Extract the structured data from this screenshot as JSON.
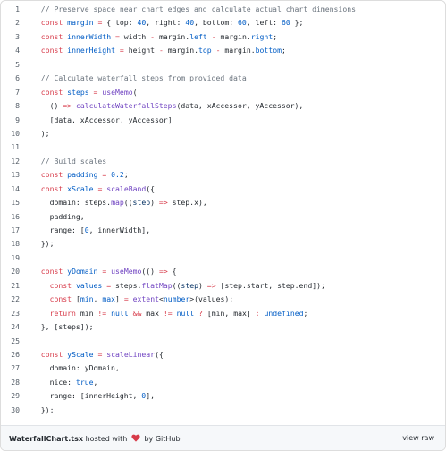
{
  "gist": {
    "lines": [
      {
        "n": "1",
        "tokens": [
          {
            "t": "  "
          },
          {
            "t": "// Preserve space near chart edges and calculate actual chart dimensions",
            "c": "cm"
          }
        ]
      },
      {
        "n": "2",
        "tokens": [
          {
            "t": "  "
          },
          {
            "t": "const",
            "c": "kw"
          },
          {
            "t": " "
          },
          {
            "t": "margin",
            "c": "cn"
          },
          {
            "t": " "
          },
          {
            "t": "=",
            "c": "kw"
          },
          {
            "t": " { top: "
          },
          {
            "t": "40",
            "c": "cn"
          },
          {
            "t": ", right: "
          },
          {
            "t": "40",
            "c": "cn"
          },
          {
            "t": ", bottom: "
          },
          {
            "t": "60",
            "c": "cn"
          },
          {
            "t": ", left: "
          },
          {
            "t": "60",
            "c": "cn"
          },
          {
            "t": " };"
          }
        ]
      },
      {
        "n": "3",
        "tokens": [
          {
            "t": "  "
          },
          {
            "t": "const",
            "c": "kw"
          },
          {
            "t": " "
          },
          {
            "t": "innerWidth",
            "c": "cn"
          },
          {
            "t": " "
          },
          {
            "t": "=",
            "c": "kw"
          },
          {
            "t": " width "
          },
          {
            "t": "-",
            "c": "kw"
          },
          {
            "t": " margin."
          },
          {
            "t": "left",
            "c": "cn"
          },
          {
            "t": " "
          },
          {
            "t": "-",
            "c": "kw"
          },
          {
            "t": " margin."
          },
          {
            "t": "right",
            "c": "cn"
          },
          {
            "t": ";"
          }
        ]
      },
      {
        "n": "4",
        "tokens": [
          {
            "t": "  "
          },
          {
            "t": "const",
            "c": "kw"
          },
          {
            "t": " "
          },
          {
            "t": "innerHeight",
            "c": "cn"
          },
          {
            "t": " "
          },
          {
            "t": "=",
            "c": "kw"
          },
          {
            "t": " height "
          },
          {
            "t": "-",
            "c": "kw"
          },
          {
            "t": " margin."
          },
          {
            "t": "top",
            "c": "cn"
          },
          {
            "t": " "
          },
          {
            "t": "-",
            "c": "kw"
          },
          {
            "t": " margin."
          },
          {
            "t": "bottom",
            "c": "cn"
          },
          {
            "t": ";"
          }
        ]
      },
      {
        "n": "5",
        "tokens": []
      },
      {
        "n": "6",
        "tokens": [
          {
            "t": "  "
          },
          {
            "t": "// Calculate waterfall steps from provided data",
            "c": "cm"
          }
        ]
      },
      {
        "n": "7",
        "tokens": [
          {
            "t": "  "
          },
          {
            "t": "const",
            "c": "kw"
          },
          {
            "t": " "
          },
          {
            "t": "steps",
            "c": "cn"
          },
          {
            "t": " "
          },
          {
            "t": "=",
            "c": "kw"
          },
          {
            "t": " "
          },
          {
            "t": "useMemo",
            "c": "fn"
          },
          {
            "t": "("
          }
        ]
      },
      {
        "n": "8",
        "tokens": [
          {
            "t": "    () "
          },
          {
            "t": "=>",
            "c": "kw"
          },
          {
            "t": " "
          },
          {
            "t": "calculateWaterfallSteps",
            "c": "fn"
          },
          {
            "t": "(data, xAccessor, yAccessor),"
          }
        ]
      },
      {
        "n": "9",
        "tokens": [
          {
            "t": "    [data, xAccessor, yAccessor]"
          }
        ]
      },
      {
        "n": "10",
        "tokens": [
          {
            "t": "  );"
          }
        ]
      },
      {
        "n": "11",
        "tokens": []
      },
      {
        "n": "12",
        "tokens": [
          {
            "t": "  "
          },
          {
            "t": "// Build scales",
            "c": "cm"
          }
        ]
      },
      {
        "n": "13",
        "tokens": [
          {
            "t": "  "
          },
          {
            "t": "const",
            "c": "kw"
          },
          {
            "t": " "
          },
          {
            "t": "padding",
            "c": "cn"
          },
          {
            "t": " "
          },
          {
            "t": "=",
            "c": "kw"
          },
          {
            "t": " "
          },
          {
            "t": "0.2",
            "c": "cn"
          },
          {
            "t": ";"
          }
        ]
      },
      {
        "n": "14",
        "tokens": [
          {
            "t": "  "
          },
          {
            "t": "const",
            "c": "kw"
          },
          {
            "t": " "
          },
          {
            "t": "xScale",
            "c": "cn"
          },
          {
            "t": " "
          },
          {
            "t": "=",
            "c": "kw"
          },
          {
            "t": " "
          },
          {
            "t": "scaleBand",
            "c": "fn"
          },
          {
            "t": "({"
          }
        ]
      },
      {
        "n": "15",
        "tokens": [
          {
            "t": "    domain: steps."
          },
          {
            "t": "map",
            "c": "fn"
          },
          {
            "t": "(("
          },
          {
            "t": "step",
            "c": "st"
          },
          {
            "t": ") "
          },
          {
            "t": "=>",
            "c": "kw"
          },
          {
            "t": " step.x),"
          }
        ]
      },
      {
        "n": "16",
        "tokens": [
          {
            "t": "    padding,"
          }
        ]
      },
      {
        "n": "17",
        "tokens": [
          {
            "t": "    range: ["
          },
          {
            "t": "0",
            "c": "cn"
          },
          {
            "t": ", innerWidth],"
          }
        ]
      },
      {
        "n": "18",
        "tokens": [
          {
            "t": "  });"
          }
        ]
      },
      {
        "n": "19",
        "tokens": []
      },
      {
        "n": "20",
        "tokens": [
          {
            "t": "  "
          },
          {
            "t": "const",
            "c": "kw"
          },
          {
            "t": " "
          },
          {
            "t": "yDomain",
            "c": "cn"
          },
          {
            "t": " "
          },
          {
            "t": "=",
            "c": "kw"
          },
          {
            "t": " "
          },
          {
            "t": "useMemo",
            "c": "fn"
          },
          {
            "t": "(() "
          },
          {
            "t": "=>",
            "c": "kw"
          },
          {
            "t": " {"
          }
        ]
      },
      {
        "n": "21",
        "tokens": [
          {
            "t": "    "
          },
          {
            "t": "const",
            "c": "kw"
          },
          {
            "t": " "
          },
          {
            "t": "values",
            "c": "cn"
          },
          {
            "t": " "
          },
          {
            "t": "=",
            "c": "kw"
          },
          {
            "t": " steps."
          },
          {
            "t": "flatMap",
            "c": "fn"
          },
          {
            "t": "(("
          },
          {
            "t": "step",
            "c": "st"
          },
          {
            "t": ") "
          },
          {
            "t": "=>",
            "c": "kw"
          },
          {
            "t": " [step.start, step.end]);"
          }
        ]
      },
      {
        "n": "22",
        "tokens": [
          {
            "t": "    "
          },
          {
            "t": "const",
            "c": "kw"
          },
          {
            "t": " ["
          },
          {
            "t": "min",
            "c": "cn"
          },
          {
            "t": ", "
          },
          {
            "t": "max",
            "c": "cn"
          },
          {
            "t": "] "
          },
          {
            "t": "=",
            "c": "kw"
          },
          {
            "t": " "
          },
          {
            "t": "extent",
            "c": "fn"
          },
          {
            "t": "<"
          },
          {
            "t": "number",
            "c": "cn"
          },
          {
            "t": ">(values);"
          }
        ]
      },
      {
        "n": "23",
        "tokens": [
          {
            "t": "    "
          },
          {
            "t": "return",
            "c": "kw"
          },
          {
            "t": " min "
          },
          {
            "t": "!=",
            "c": "kw"
          },
          {
            "t": " "
          },
          {
            "t": "null",
            "c": "cn"
          },
          {
            "t": " "
          },
          {
            "t": "&&",
            "c": "kw"
          },
          {
            "t": " max "
          },
          {
            "t": "!=",
            "c": "kw"
          },
          {
            "t": " "
          },
          {
            "t": "null",
            "c": "cn"
          },
          {
            "t": " "
          },
          {
            "t": "?",
            "c": "kw"
          },
          {
            "t": " [min, max] "
          },
          {
            "t": ":",
            "c": "kw"
          },
          {
            "t": " "
          },
          {
            "t": "undefined",
            "c": "cn"
          },
          {
            "t": ";"
          }
        ]
      },
      {
        "n": "24",
        "tokens": [
          {
            "t": "  }, [steps]);"
          }
        ]
      },
      {
        "n": "25",
        "tokens": []
      },
      {
        "n": "26",
        "tokens": [
          {
            "t": "  "
          },
          {
            "t": "const",
            "c": "kw"
          },
          {
            "t": " "
          },
          {
            "t": "yScale",
            "c": "cn"
          },
          {
            "t": " "
          },
          {
            "t": "=",
            "c": "kw"
          },
          {
            "t": " "
          },
          {
            "t": "scaleLinear",
            "c": "fn"
          },
          {
            "t": "({"
          }
        ]
      },
      {
        "n": "27",
        "tokens": [
          {
            "t": "    domain: yDomain,"
          }
        ]
      },
      {
        "n": "28",
        "tokens": [
          {
            "t": "    nice: "
          },
          {
            "t": "true",
            "c": "cn"
          },
          {
            "t": ","
          }
        ]
      },
      {
        "n": "29",
        "tokens": [
          {
            "t": "    range: [innerHeight, "
          },
          {
            "t": "0",
            "c": "cn"
          },
          {
            "t": "],"
          }
        ]
      },
      {
        "n": "30",
        "tokens": [
          {
            "t": "  });"
          }
        ]
      }
    ],
    "footer": {
      "filename": "WaterfallChart.tsx",
      "hosted_with": "hosted with",
      "heart_icon": "heart-icon",
      "by": "by",
      "github": "GitHub",
      "view_raw": "view raw"
    },
    "colors": {
      "comment": "#6a737d",
      "keyword": "#d73a49",
      "function": "#6f42c1",
      "constant": "#005cc5",
      "string": "#032f62",
      "plain": "#24292f",
      "heart": "#d73a49"
    }
  }
}
